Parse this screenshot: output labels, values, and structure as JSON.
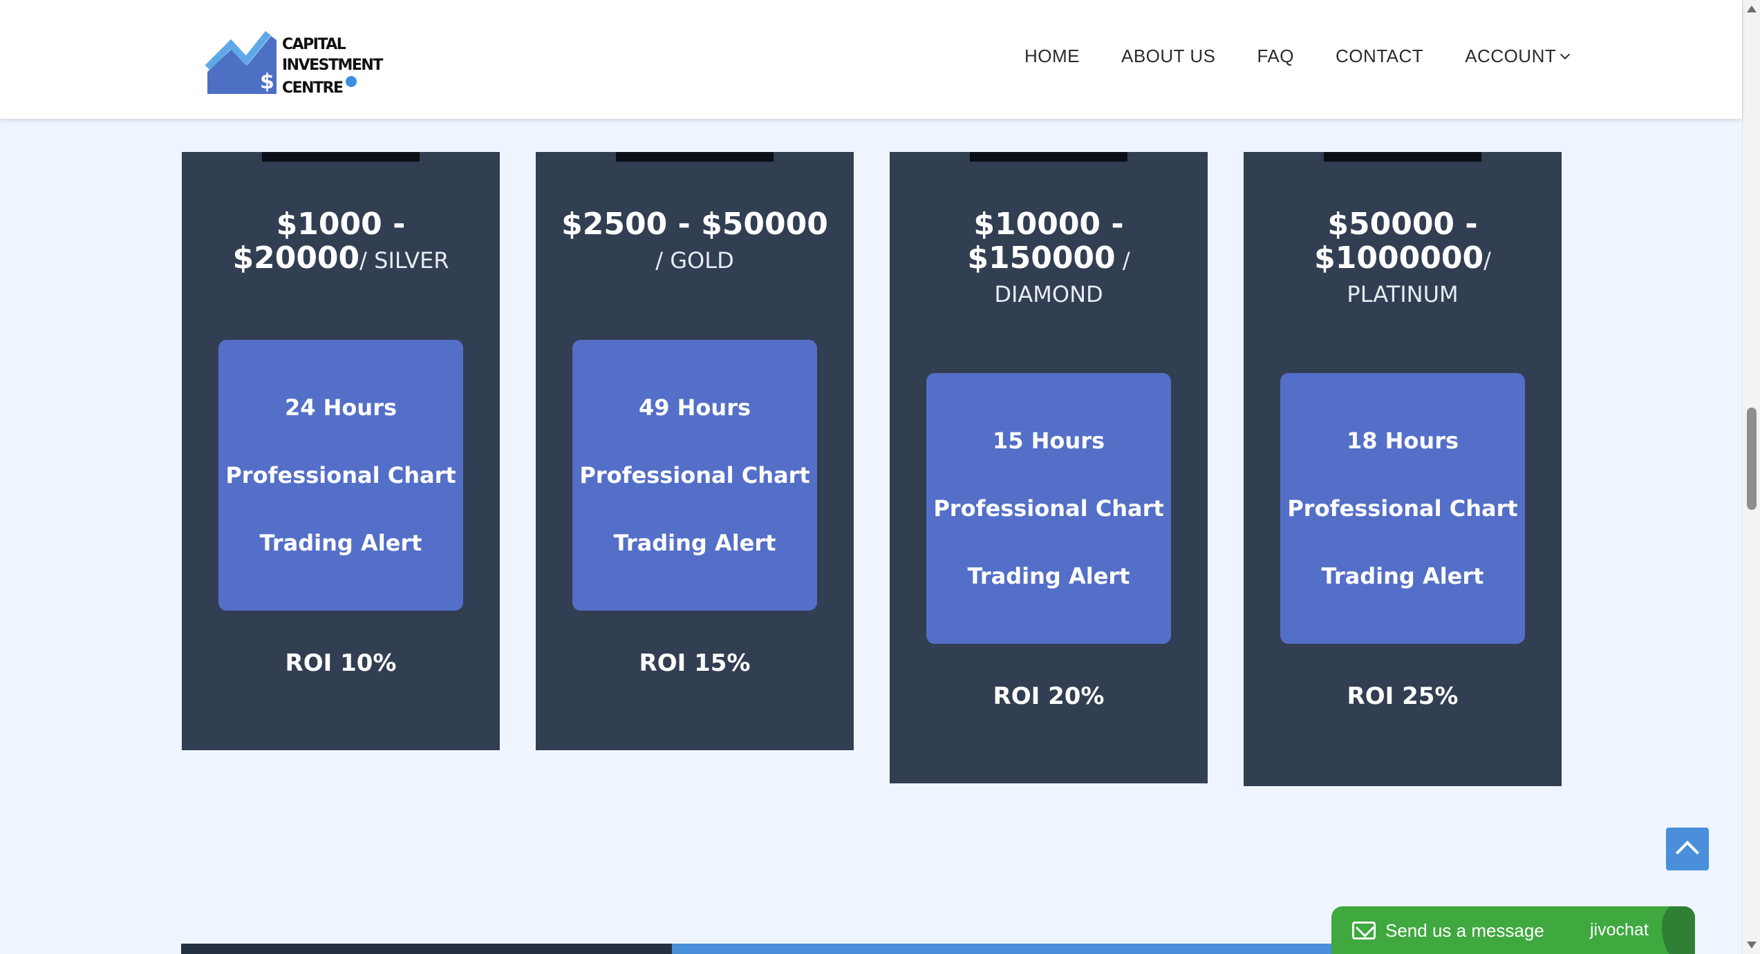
{
  "header": {
    "logo": {
      "line1": "CAPITAL",
      "line2": "INVESTMENT",
      "line3": "CENTRE"
    },
    "nav": [
      {
        "label": "HOME"
      },
      {
        "label": "ABOUT US"
      },
      {
        "label": "FAQ"
      },
      {
        "label": "CONTACT"
      },
      {
        "label": "ACCOUNT"
      }
    ]
  },
  "plans": [
    {
      "price_line1": "$1000 -",
      "price_line2": "$20000",
      "tier": "/ SILVER",
      "hours": "24 Hours",
      "feature1": "Professional Chart",
      "feature2": "Trading Alert",
      "roi": "ROI 10%"
    },
    {
      "price_line1": "$2500 - $50000",
      "price_line2": "",
      "tier": "/ GOLD",
      "hours": "49 Hours",
      "feature1": "Professional Chart",
      "feature2": "Trading Alert",
      "roi": "ROI 15%"
    },
    {
      "price_line1": "$10000 -",
      "price_line2": "$150000",
      "tier": " /",
      "tier_line2": "DIAMOND",
      "hours": "15 Hours",
      "feature1": "Professional Chart",
      "feature2": "Trading Alert",
      "roi": "ROI 20%"
    },
    {
      "price_line1": "$50000 -",
      "price_line2": "$1000000",
      "tier": "/",
      "tier_line2": "PLATINUM",
      "hours": "18 Hours",
      "feature1": "Professional Chart",
      "feature2": "Trading Alert",
      "roi": "ROI 25%"
    }
  ],
  "chat": {
    "message": "Send us a message",
    "brand": "jivochat"
  },
  "colors": {
    "card": "#323e51",
    "box": "#546fc8",
    "accent": "#4a8fd9",
    "chat": "#3fa83f",
    "page_bg": "#eef5fe"
  }
}
